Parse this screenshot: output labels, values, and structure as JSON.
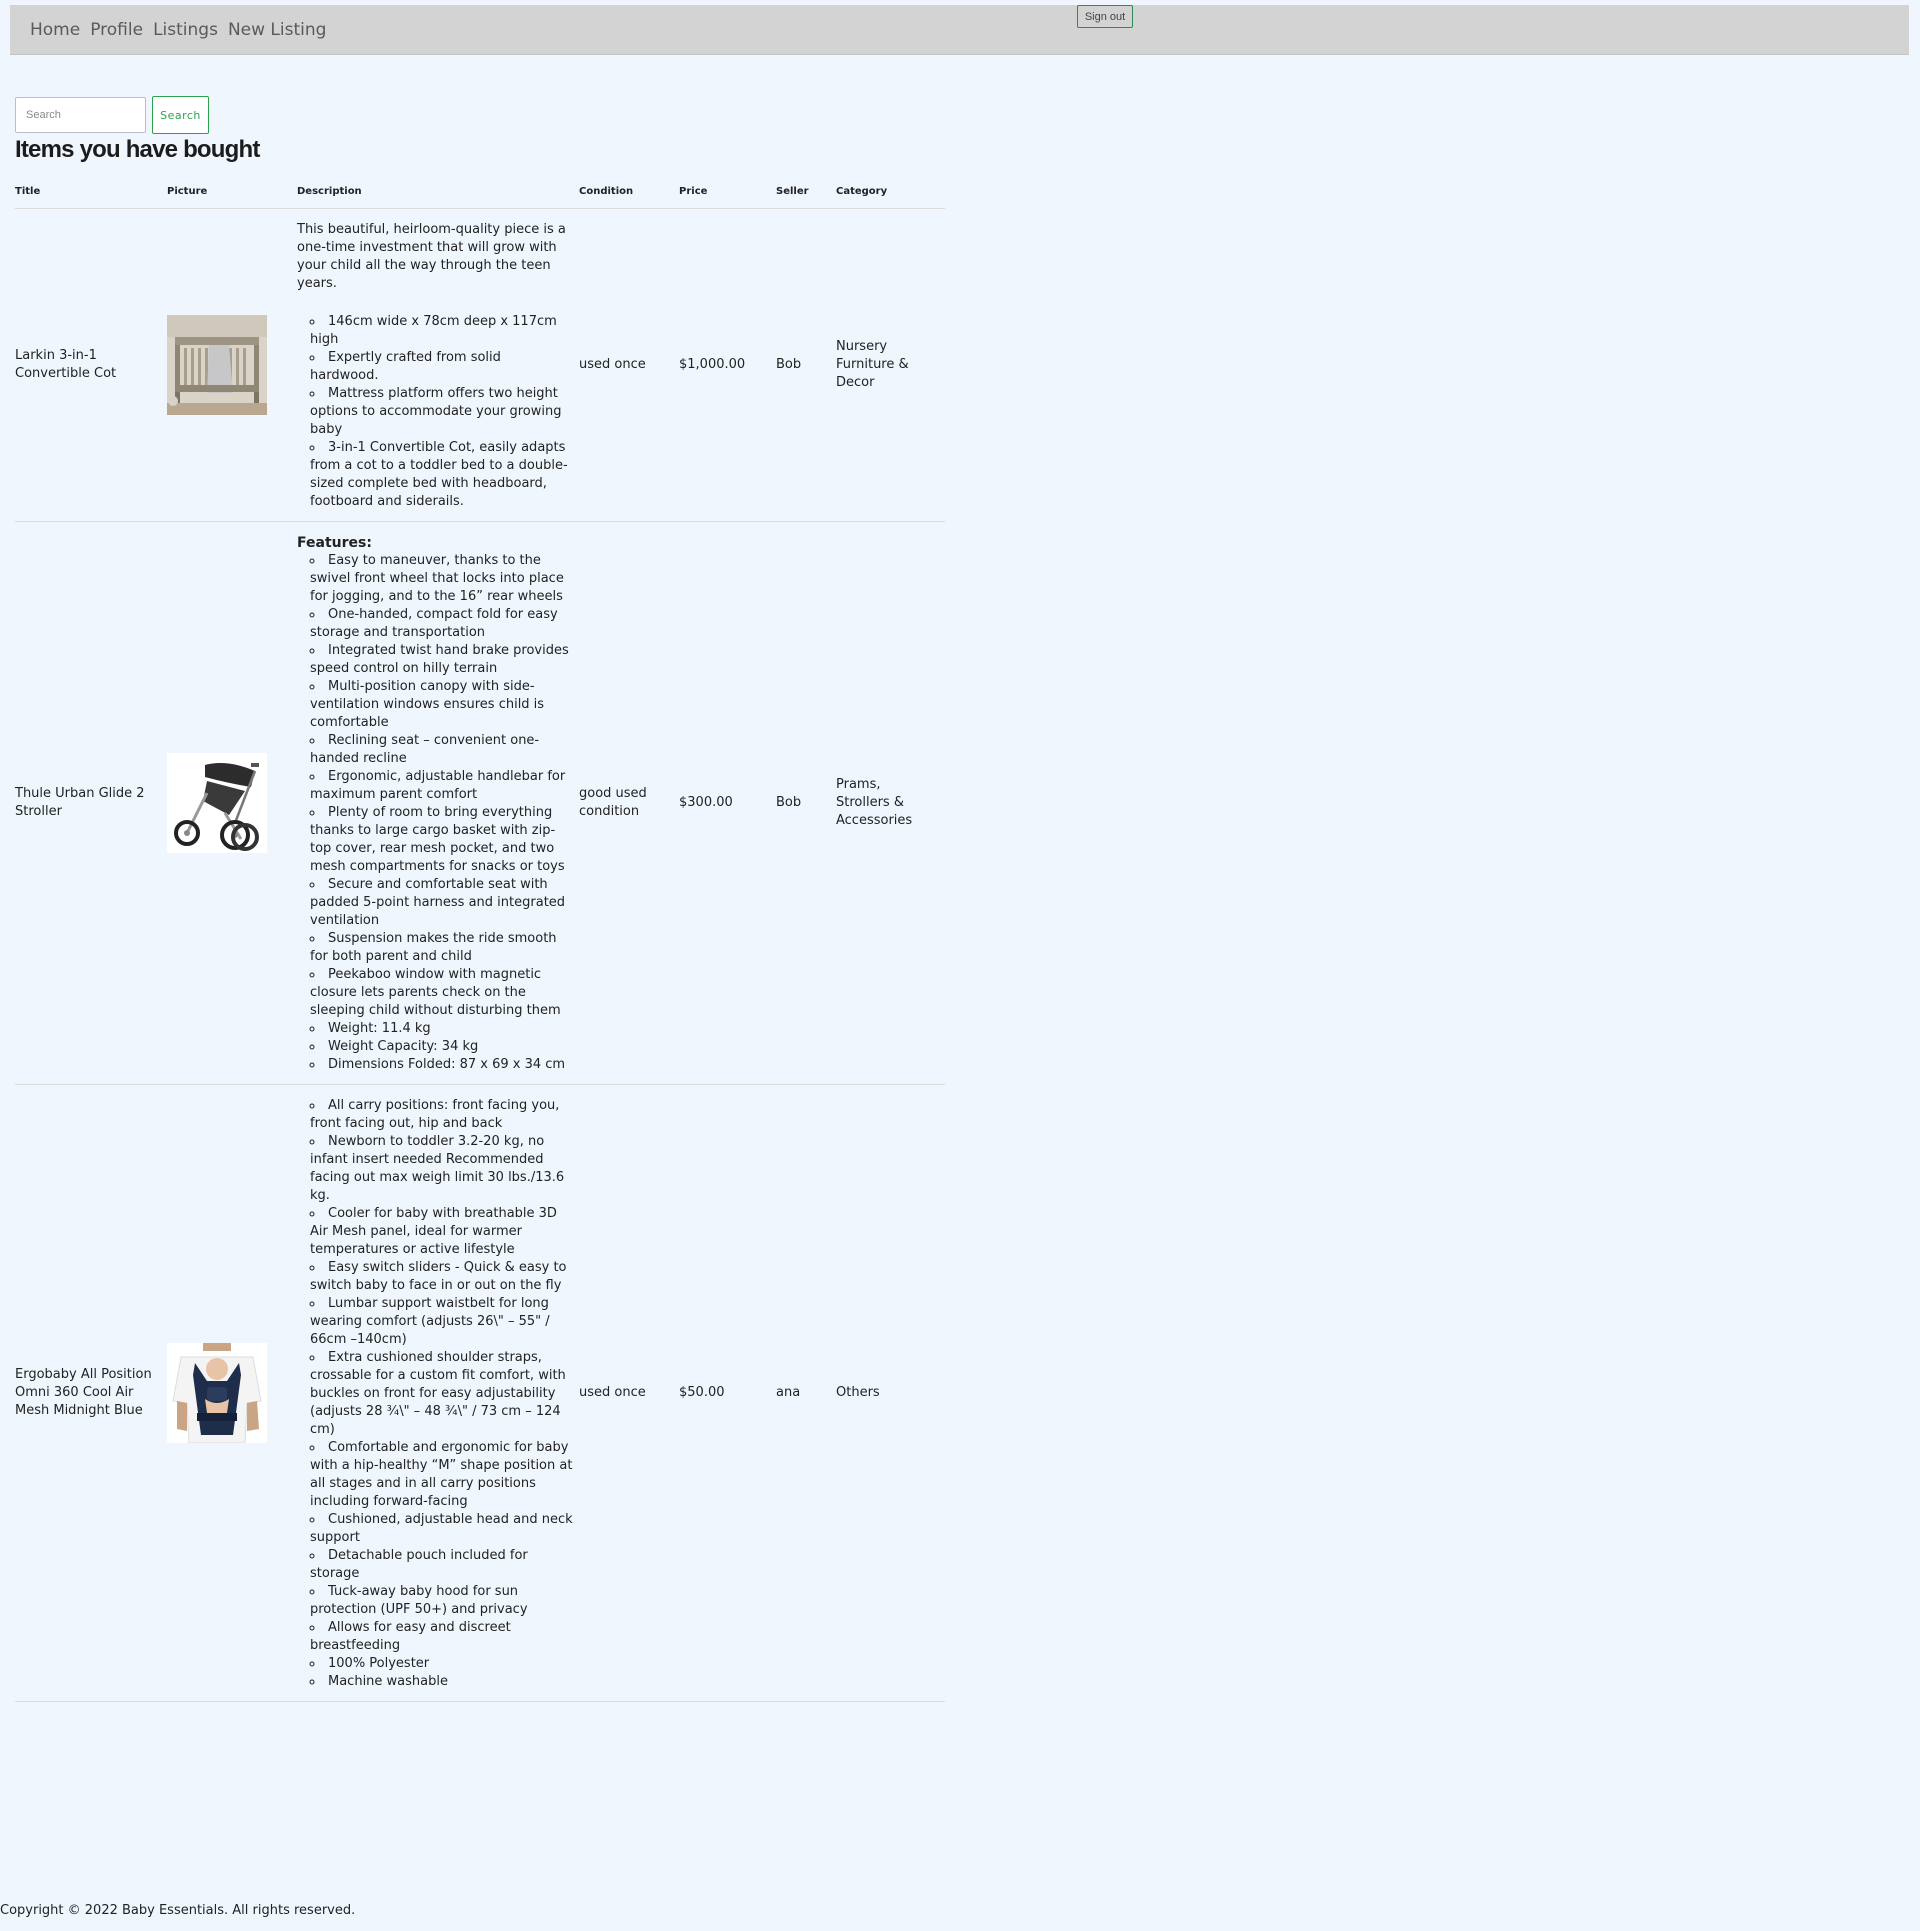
{
  "nav": {
    "links": [
      "Home",
      "Profile",
      "Listings",
      "New Listing"
    ],
    "sign_out": "Sign out"
  },
  "search": {
    "placeholder": "Search",
    "button": "Search"
  },
  "page_title": "Items you have bought",
  "table": {
    "headers": [
      "Title",
      "Picture",
      "Description",
      "Condition",
      "Price",
      "Seller",
      "Category"
    ],
    "rows": [
      {
        "title": "Larkin 3-in-1 Convertible Cot",
        "picture": "cot-photo",
        "description_intro": "This beautiful, heirloom-quality piece is a one-time investment that will grow with your child all the way through the teen years.",
        "description_heading": "",
        "description_items": [
          "146cm wide x 78cm deep x 117cm high",
          "Expertly crafted from solid hardwood.",
          "Mattress platform offers two height options to accommodate your growing baby",
          "3-in-1 Convertible Cot, easily adapts from a cot to a toddler bed to a double-sized complete bed with headboard, footboard and siderails."
        ],
        "condition": "used once",
        "price": "$1,000.00",
        "seller": "Bob",
        "category": "Nursery Furniture & Decor"
      },
      {
        "title": "Thule Urban Glide 2 Stroller",
        "picture": "stroller-photo",
        "description_intro": "",
        "description_heading": "Features:",
        "description_items": [
          "Easy to maneuver, thanks to the swivel front wheel that locks into place for jogging, and to the 16” rear wheels",
          "One-handed, compact fold for easy storage and transportation",
          "Integrated twist hand brake provides speed control on hilly terrain",
          "Multi-position canopy with side-ventilation windows ensures child is comfortable",
          "Reclining seat – convenient one-handed recline",
          "Ergonomic, adjustable handlebar for maximum parent comfort",
          "Plenty of room to bring everything thanks to large cargo basket with zip-top cover, rear mesh pocket, and two mesh compartments for snacks or toys",
          "Secure and comfortable seat with padded 5-point harness and integrated ventilation",
          "Suspension makes the ride smooth for both parent and child",
          "Peekaboo window with magnetic closure lets parents check on the sleeping child without disturbing them",
          "Weight: 11.4 kg",
          "Weight Capacity: 34 kg",
          "Dimensions Folded: 87 x 69 x 34 cm"
        ],
        "condition": "good used condition",
        "price": "$300.00",
        "seller": "Bob",
        "category": "Prams, Strollers & Accessories"
      },
      {
        "title": "Ergobaby All Position Omni 360 Cool Air Mesh Midnight Blue",
        "picture": "baby-carrier-photo",
        "description_intro": "",
        "description_heading": "",
        "description_items": [
          "All carry positions: front facing you, front facing out, hip and back",
          "Newborn to toddler 3.2-20 kg, no infant insert needed Recommended facing out max weigh limit 30 lbs./13.6 kg.",
          "Cooler for baby with breathable 3D Air Mesh panel, ideal for warmer temperatures or active lifestyle",
          "Easy switch sliders - Quick & easy to switch baby to face in or out on the fly",
          "Lumbar support waistbelt for long wearing comfort (adjusts 26\\\" – 55\" / 66cm –140cm)",
          "Extra cushioned shoulder straps, crossable for a custom fit comfort, with buckles on front for easy adjustability (adjusts 28 ¾\\\" – 48 ¾\\\" / 73 cm – 124 cm)",
          "Comfortable and ergonomic for baby with a hip-healthy “M” shape position at all stages and in all carry positions including forward-facing",
          "Cushioned, adjustable head and neck support",
          "Detachable pouch included for storage",
          "Tuck-away baby hood for sun protection (UPF 50+) and privacy",
          "Allows for easy and discreet breastfeeding",
          "100% Polyester",
          "Machine washable"
        ],
        "condition": "used once",
        "price": "$50.00",
        "seller": "ana",
        "category": "Others"
      }
    ]
  },
  "footer": "Copyright © 2022 Baby Essentials. All rights reserved."
}
